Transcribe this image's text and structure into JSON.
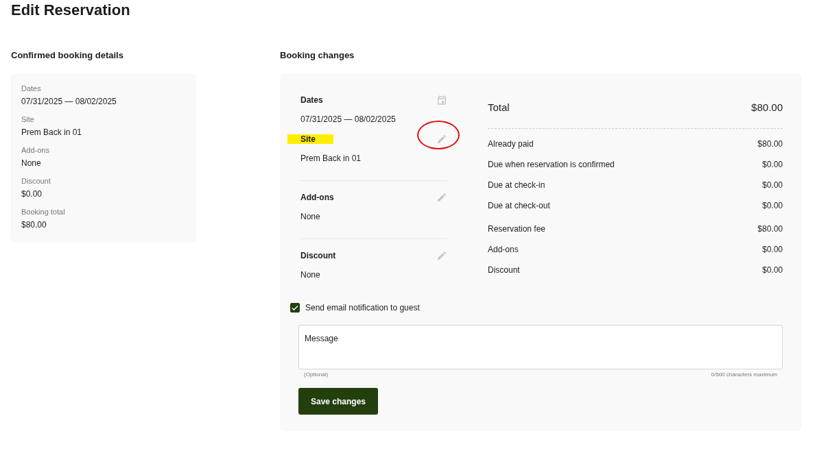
{
  "page_title": "Edit Reservation",
  "confirmed": {
    "heading": "Confirmed booking details",
    "fields": [
      {
        "label": "Dates",
        "value": "07/31/2025 — 08/02/2025"
      },
      {
        "label": "Site",
        "value": "Prem Back in 01"
      },
      {
        "label": "Add-ons",
        "value": "None"
      },
      {
        "label": "Discount",
        "value": "$0.00"
      },
      {
        "label": "Booking total",
        "value": "$80.00"
      }
    ]
  },
  "changes": {
    "heading": "Booking changes",
    "sections": [
      {
        "items": [
          {
            "label": "Dates",
            "value": "07/31/2025 — 08/02/2025",
            "kind": "date",
            "highlighted": false,
            "circled": false
          },
          {
            "label": "Site",
            "value": "Prem Back in 01",
            "kind": "editable",
            "highlighted": true,
            "circled": true
          }
        ]
      },
      {
        "items": [
          {
            "label": "Add-ons",
            "value": "None",
            "kind": "editable",
            "highlighted": false,
            "circled": false
          }
        ]
      },
      {
        "items": [
          {
            "label": "Discount",
            "value": "None",
            "kind": "editable",
            "highlighted": false,
            "circled": false
          }
        ]
      }
    ],
    "total": {
      "label": "Total",
      "value": "$80.00"
    },
    "summary_groups": [
      [
        {
          "label": "Already paid",
          "value": "$80.00"
        },
        {
          "label": "Due when reservation is confirmed",
          "value": "$0.00"
        },
        {
          "label": "Due at check-in",
          "value": "$0.00"
        },
        {
          "label": "Due at check-out",
          "value": "$0.00"
        }
      ],
      [
        {
          "label": "Reservation fee",
          "value": "$80.00"
        },
        {
          "label": "Add-ons",
          "value": "$0.00"
        },
        {
          "label": "Discount",
          "value": "$0.00"
        }
      ]
    ],
    "notify": {
      "label": "Send email notification to guest",
      "checked": true
    },
    "message": {
      "placeholder": "Message",
      "hint": "(Optional)",
      "counter": "0/500 characters maximum"
    },
    "save_button": "Save changes"
  }
}
